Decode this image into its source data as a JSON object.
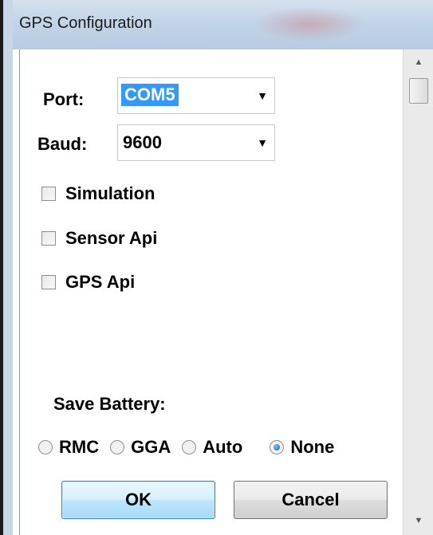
{
  "window": {
    "title": "GPS Configuration"
  },
  "port": {
    "label": "Port:",
    "value": "COM5"
  },
  "baud": {
    "label": "Baud:",
    "value": "9600"
  },
  "checkboxes": [
    {
      "label": "Simulation",
      "checked": false
    },
    {
      "label": "Sensor Api",
      "checked": false
    },
    {
      "label": "GPS Api",
      "checked": false
    }
  ],
  "save_battery": {
    "label": "Save Battery:",
    "options": [
      {
        "label": "RMC",
        "selected": false
      },
      {
        "label": "GGA",
        "selected": false
      },
      {
        "label": "Auto",
        "selected": false
      },
      {
        "label": "None",
        "selected": true
      }
    ]
  },
  "buttons": {
    "ok": "OK",
    "cancel": "Cancel"
  },
  "icons": {
    "dropdown": "chevron-down-icon",
    "scroll_up": "scroll-up-icon",
    "scroll_down": "scroll-down-icon"
  }
}
